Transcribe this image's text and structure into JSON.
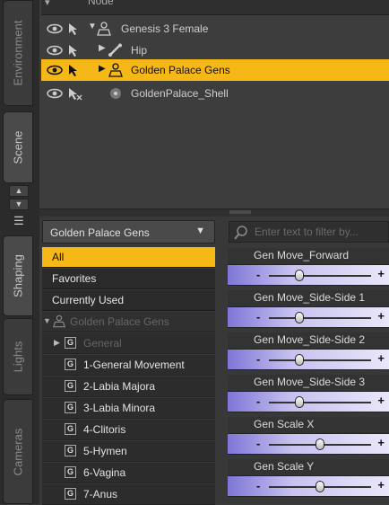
{
  "tabs": {
    "environment": "Environment",
    "scene": "Scene",
    "shaping": "Shaping",
    "lights": "Lights",
    "cameras": "Cameras"
  },
  "scene": {
    "header_label": "Node",
    "rows": [
      {
        "label": "Genesis 3 Female",
        "icon": "figure-icon"
      },
      {
        "label": "Hip",
        "icon": "bone-icon"
      },
      {
        "label": "Golden Palace Gens",
        "icon": "figure-icon",
        "selected": true
      },
      {
        "label": "GoldenPalace_Shell",
        "icon": "geometry-icon"
      }
    ]
  },
  "shaping": {
    "dropdown_value": "Golden Palace Gens",
    "categories": [
      "All",
      "Favorites",
      "Currently Used"
    ],
    "tree_root": "Golden Palace Gens",
    "tree_items": [
      "General",
      "1-General Movement",
      "2-Labia Majora",
      "3-Labia Minora",
      "4-Clitoris",
      "5-Hymen",
      "6-Vagina",
      "7-Anus"
    ],
    "group_glyph": "G",
    "filter_placeholder": "Enter text to filter by...",
    "sliders": [
      {
        "name": "Gen Move_Forward",
        "value": 0.3
      },
      {
        "name": "Gen Move_Side-Side 1",
        "value": 0.3
      },
      {
        "name": "Gen Move_Side-Side 2",
        "value": 0.3
      },
      {
        "name": "Gen Move_Side-Side 3",
        "value": 0.3
      },
      {
        "name": "Gen Scale X",
        "value": 0.5
      },
      {
        "name": "Gen Scale Y",
        "value": 0.5
      }
    ],
    "minus": "-",
    "plus": "+"
  },
  "colors": {
    "selection": "#f6b817",
    "slider_fill": "#7e76d6"
  }
}
